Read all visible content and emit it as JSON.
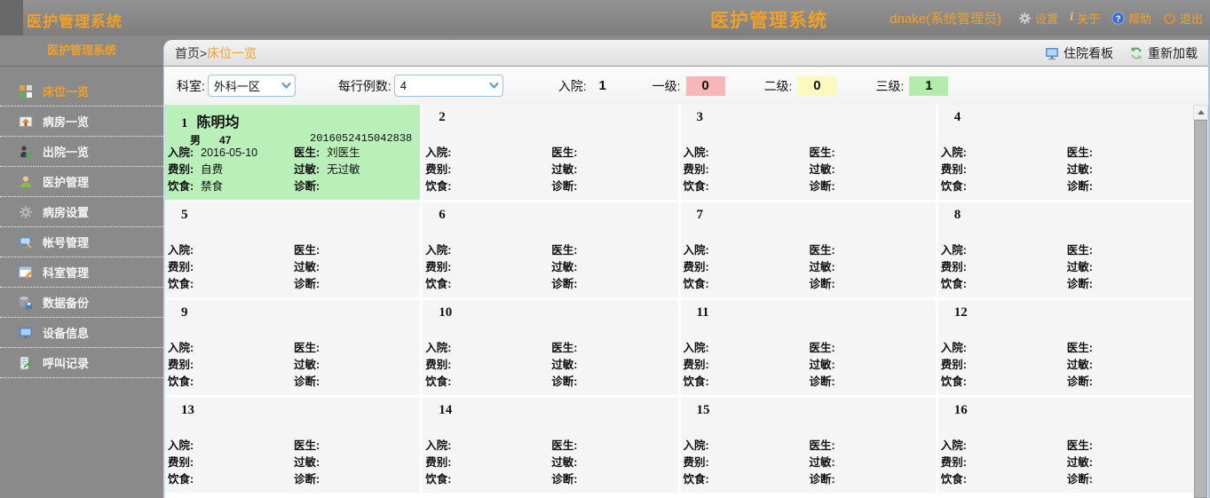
{
  "header": {
    "app_title_left": "医护管理系统",
    "app_title_right": "医护管理系统",
    "user": "dnake(系统管理员)",
    "settings_label": "设置",
    "about_i": "i",
    "about_label": "关于",
    "help_label": "帮助",
    "logout_label": "退出"
  },
  "sidebar": {
    "title": "医护管理系统",
    "items": [
      {
        "label": "床位一览",
        "icon": "bed-grid",
        "name": "beds-overview",
        "active": true
      },
      {
        "label": "病房一览",
        "icon": "ward-house",
        "name": "wards-overview",
        "active": false
      },
      {
        "label": "出院一览",
        "icon": "discharge-person",
        "name": "discharge-overview",
        "active": false
      },
      {
        "label": "医护管理",
        "icon": "staff-person",
        "name": "staff-management",
        "active": false
      },
      {
        "label": "病房设置",
        "icon": "gear",
        "name": "ward-settings",
        "active": false
      },
      {
        "label": "帐号管理",
        "icon": "account-monitor",
        "name": "account-management",
        "active": false
      },
      {
        "label": "科室管理",
        "icon": "dept-edit",
        "name": "department-management",
        "active": false
      },
      {
        "label": "数据备份",
        "icon": "backup-db",
        "name": "data-backup",
        "active": false
      },
      {
        "label": "设备信息",
        "icon": "device-monitor",
        "name": "device-info",
        "active": false
      },
      {
        "label": "呼叫记录",
        "icon": "call-log",
        "name": "call-records",
        "active": false
      }
    ]
  },
  "breadcrumb": {
    "home": "首页",
    "sep": ">",
    "current": "床位一览"
  },
  "toolbar": {
    "board_label": "住院看板",
    "reload_label": "重新加载"
  },
  "filters": {
    "dept_label": "科室:",
    "dept_value": "外科一区",
    "per_row_label": "每行例数:",
    "per_row_value": "4",
    "stats": [
      {
        "label": "入院:",
        "value": "1",
        "color": "none"
      },
      {
        "label": "一级:",
        "value": "0",
        "color": "#f8b6b6"
      },
      {
        "label": "二级:",
        "value": "0",
        "color": "#fafabe"
      },
      {
        "label": "三级:",
        "value": "1",
        "color": "#b2eeaa"
      }
    ]
  },
  "card_labels": {
    "admission": "入院:",
    "doctor": "医生:",
    "fee": "费别:",
    "allergy": "过敏:",
    "diet": "饮食:",
    "diagnosis": "诊断:"
  },
  "beds": [
    {
      "number": "1",
      "name": "陈明均",
      "gender": "男",
      "age": "47",
      "patient_id": "2016052415042838",
      "admission": "2016-05-10",
      "doctor": "刘医生",
      "fee": "自费",
      "allergy": "无过敏",
      "diet": "禁食",
      "diagnosis": "",
      "occupied": true
    },
    {
      "number": "2",
      "name": "",
      "gender": "",
      "age": "",
      "patient_id": "",
      "admission": "",
      "doctor": "",
      "fee": "",
      "allergy": "",
      "diet": "",
      "diagnosis": "",
      "occupied": false
    },
    {
      "number": "3",
      "name": "",
      "gender": "",
      "age": "",
      "patient_id": "",
      "admission": "",
      "doctor": "",
      "fee": "",
      "allergy": "",
      "diet": "",
      "diagnosis": "",
      "occupied": false
    },
    {
      "number": "4",
      "name": "",
      "gender": "",
      "age": "",
      "patient_id": "",
      "admission": "",
      "doctor": "",
      "fee": "",
      "allergy": "",
      "diet": "",
      "diagnosis": "",
      "occupied": false
    },
    {
      "number": "5",
      "name": "",
      "gender": "",
      "age": "",
      "patient_id": "",
      "admission": "",
      "doctor": "",
      "fee": "",
      "allergy": "",
      "diet": "",
      "diagnosis": "",
      "occupied": false
    },
    {
      "number": "6",
      "name": "",
      "gender": "",
      "age": "",
      "patient_id": "",
      "admission": "",
      "doctor": "",
      "fee": "",
      "allergy": "",
      "diet": "",
      "diagnosis": "",
      "occupied": false
    },
    {
      "number": "7",
      "name": "",
      "gender": "",
      "age": "",
      "patient_id": "",
      "admission": "",
      "doctor": "",
      "fee": "",
      "allergy": "",
      "diet": "",
      "diagnosis": "",
      "occupied": false
    },
    {
      "number": "8",
      "name": "",
      "gender": "",
      "age": "",
      "patient_id": "",
      "admission": "",
      "doctor": "",
      "fee": "",
      "allergy": "",
      "diet": "",
      "diagnosis": "",
      "occupied": false
    },
    {
      "number": "9",
      "name": "",
      "gender": "",
      "age": "",
      "patient_id": "",
      "admission": "",
      "doctor": "",
      "fee": "",
      "allergy": "",
      "diet": "",
      "diagnosis": "",
      "occupied": false
    },
    {
      "number": "10",
      "name": "",
      "gender": "",
      "age": "",
      "patient_id": "",
      "admission": "",
      "doctor": "",
      "fee": "",
      "allergy": "",
      "diet": "",
      "diagnosis": "",
      "occupied": false
    },
    {
      "number": "11",
      "name": "",
      "gender": "",
      "age": "",
      "patient_id": "",
      "admission": "",
      "doctor": "",
      "fee": "",
      "allergy": "",
      "diet": "",
      "diagnosis": "",
      "occupied": false
    },
    {
      "number": "12",
      "name": "",
      "gender": "",
      "age": "",
      "patient_id": "",
      "admission": "",
      "doctor": "",
      "fee": "",
      "allergy": "",
      "diet": "",
      "diagnosis": "",
      "occupied": false
    },
    {
      "number": "13",
      "name": "",
      "gender": "",
      "age": "",
      "patient_id": "",
      "admission": "",
      "doctor": "",
      "fee": "",
      "allergy": "",
      "diet": "",
      "diagnosis": "",
      "occupied": false
    },
    {
      "number": "14",
      "name": "",
      "gender": "",
      "age": "",
      "patient_id": "",
      "admission": "",
      "doctor": "",
      "fee": "",
      "allergy": "",
      "diet": "",
      "diagnosis": "",
      "occupied": false
    },
    {
      "number": "15",
      "name": "",
      "gender": "",
      "age": "",
      "patient_id": "",
      "admission": "",
      "doctor": "",
      "fee": "",
      "allergy": "",
      "diet": "",
      "diagnosis": "",
      "occupied": false
    },
    {
      "number": "16",
      "name": "",
      "gender": "",
      "age": "",
      "patient_id": "",
      "admission": "",
      "doctor": "",
      "fee": "",
      "allergy": "",
      "diet": "",
      "diagnosis": "",
      "occupied": false
    }
  ],
  "colors": {
    "accent_orange": "#f0a028",
    "occupied_green": "#b9f0b9",
    "level1_pink": "#f8b6b6",
    "level2_yellow": "#fafabe",
    "level3_green": "#b2eeaa",
    "sidebar_gray": "#8a8a8a"
  }
}
